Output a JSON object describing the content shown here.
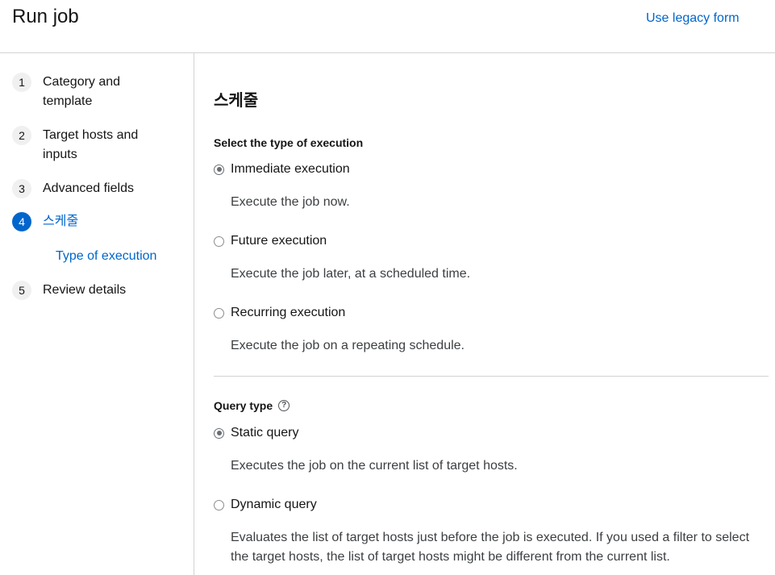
{
  "header": {
    "title": "Run job",
    "legacy_link": "Use legacy form"
  },
  "wizard": {
    "steps": [
      {
        "number": "1",
        "label": "Category and template"
      },
      {
        "number": "2",
        "label": "Target hosts and inputs"
      },
      {
        "number": "3",
        "label": "Advanced fields"
      },
      {
        "number": "4",
        "label": "스케줄"
      },
      {
        "number": "5",
        "label": "Review details"
      }
    ],
    "active_step": "4",
    "active_substep": "Type of execution"
  },
  "main": {
    "section_title": "스케줄",
    "execution": {
      "label": "Select the type of execution",
      "options": [
        {
          "label": "Immediate execution",
          "description": "Execute the job now.",
          "checked": true
        },
        {
          "label": "Future execution",
          "description": "Execute the job later, at a scheduled time.",
          "checked": false
        },
        {
          "label": "Recurring execution",
          "description": "Execute the job on a repeating schedule.",
          "checked": false
        }
      ]
    },
    "query": {
      "label": "Query type",
      "help_icon": "?",
      "options": [
        {
          "label": "Static query",
          "description": "Executes the job on the current list of target hosts.",
          "checked": true
        },
        {
          "label": "Dynamic query",
          "description": "Evaluates the list of target hosts just before the job is executed. If you used a filter to select the target hosts, the list of target hosts might be different from the current list.",
          "checked": false
        }
      ]
    }
  }
}
